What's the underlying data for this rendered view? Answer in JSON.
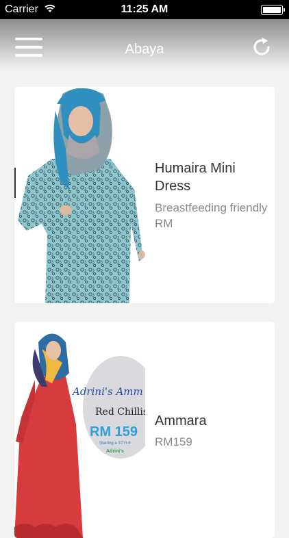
{
  "status_bar": {
    "carrier": "Carrier",
    "time": "11:25 AM"
  },
  "nav": {
    "title": "Abaya"
  },
  "products": [
    {
      "name": "Humaira Mini Dress",
      "description": "Breastfeeding friendly RM"
    },
    {
      "name": "Ammara",
      "description": "RM159",
      "image_text": {
        "brand": "Adrini's Amm",
        "tagline": "Red Chillis",
        "price": "RM 159",
        "subline": "Starting a STYLE",
        "logo": "Adrini's"
      }
    }
  ]
}
